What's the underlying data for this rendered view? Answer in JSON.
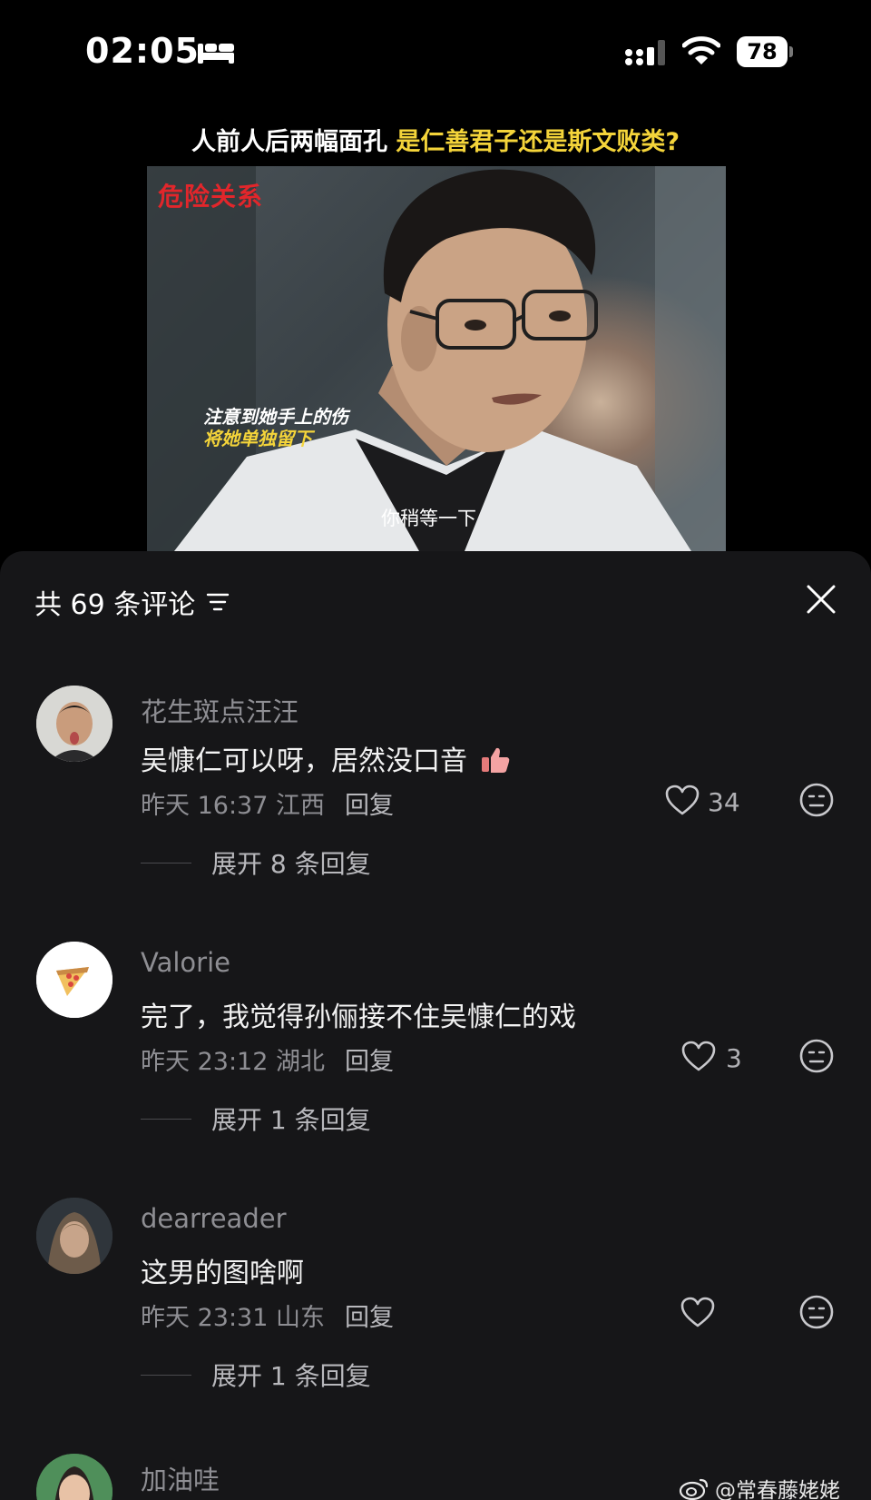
{
  "status_bar": {
    "time": "02:05",
    "battery": "78"
  },
  "video": {
    "caption_white": "人前人后两幅面孔 ",
    "caption_yellow": "是仁善君子还是斯文败类?",
    "logo": "危险关系",
    "subtitle_line1": "注意到她手上的伤",
    "subtitle_line2": "将她单独留下",
    "subtitle_bottom": "你稍等一下"
  },
  "comments_panel": {
    "header": "共 69 条评论",
    "comments": [
      {
        "user": "花生斑点汪汪",
        "text": "吴慷仁可以呀，居然没口音",
        "time": "昨天 16:37 江西",
        "reply": "回复",
        "likes": "34",
        "expand": "展开 8 条回复"
      },
      {
        "user": "Valorie",
        "text": "完了，我觉得孙俪接不住吴慷仁的戏",
        "time": "昨天 23:12 湖北",
        "reply": "回复",
        "likes": "3",
        "expand": "展开 1 条回复"
      },
      {
        "user": "dearreader",
        "text": "这男的图啥啊",
        "time": "昨天 23:31 山东",
        "reply": "回复",
        "likes": "",
        "expand": "展开 1 条回复"
      },
      {
        "user": "加油哇",
        "text": "",
        "time": "",
        "reply": "",
        "likes": "",
        "expand": ""
      }
    ]
  },
  "watermark": "@常春藤姥姥"
}
